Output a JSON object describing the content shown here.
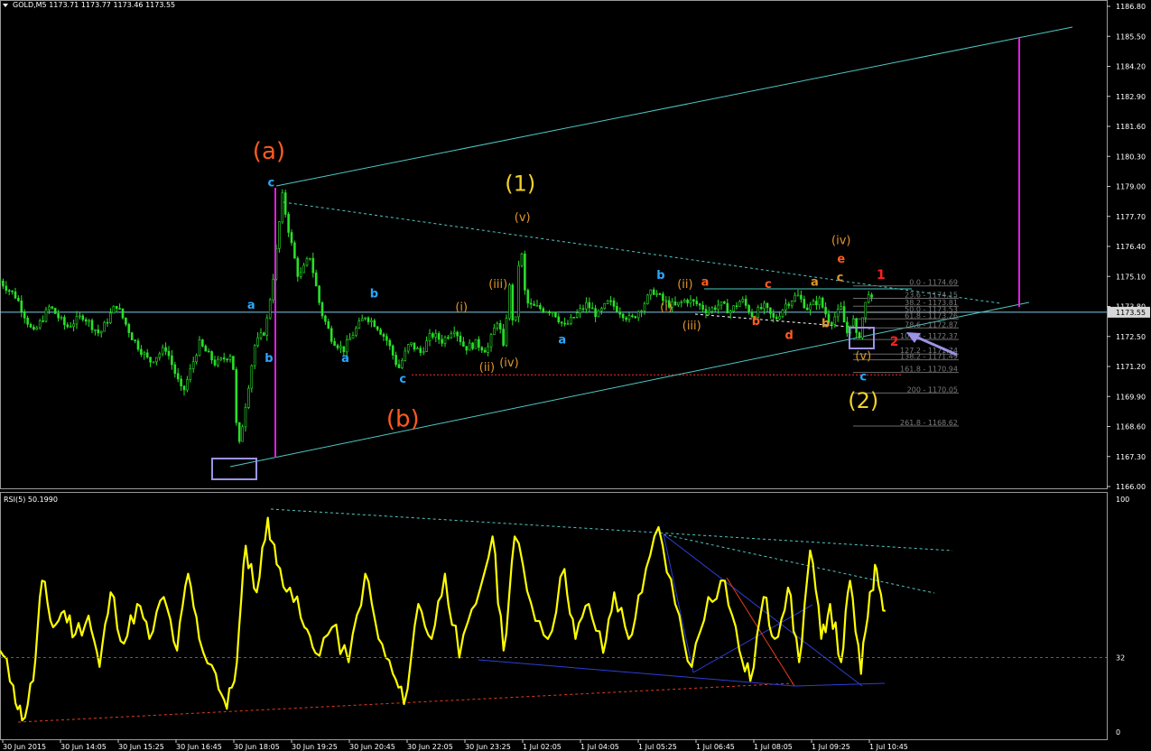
{
  "chart_data": [
    {
      "type": "candlestick",
      "title": "GOLD,M5 1173.71 1173.77 1173.46 1173.55",
      "symbol": "GOLD",
      "timeframe": "M5",
      "ohlc_header": {
        "open": 1173.71,
        "high": 1173.77,
        "low": 1173.46,
        "close": 1173.55
      },
      "current_price": 1173.55,
      "y_ticks": [
        1186.8,
        1185.5,
        1184.2,
        1182.9,
        1181.6,
        1180.3,
        1179.0,
        1177.7,
        1176.4,
        1175.1,
        1173.8,
        1172.5,
        1171.2,
        1169.9,
        1168.6,
        1167.3,
        1166.0
      ],
      "ylim": [
        1166.0,
        1187.4
      ],
      "x_ticks": [
        "30 Jun 2015",
        "30 Jun 14:05",
        "30 Jun 15:25",
        "30 Jun 16:45",
        "30 Jun 18:05",
        "30 Jun 19:25",
        "30 Jun 20:45",
        "30 Jun 22:05",
        "30 Jun 23:25",
        "1 Jul 02:05",
        "1 Jul 04:05",
        "1 Jul 05:25",
        "1 Jul 06:45",
        "1 Jul 08:05",
        "1 Jul 09:25",
        "1 Jul 10:45"
      ],
      "price_path": [
        [
          0,
          1174.9
        ],
        [
          0.015,
          1174.2
        ],
        [
          0.03,
          1172.6
        ],
        [
          0.045,
          1173.8
        ],
        [
          0.06,
          1172.9
        ],
        [
          0.075,
          1173.4
        ],
        [
          0.09,
          1172.6
        ],
        [
          0.105,
          1173.9
        ],
        [
          0.12,
          1172.4
        ],
        [
          0.135,
          1171.4
        ],
        [
          0.15,
          1172.0
        ],
        [
          0.165,
          1170.0
        ],
        [
          0.18,
          1172.2
        ],
        [
          0.195,
          1171.3
        ],
        [
          0.21,
          1171.8
        ],
        [
          0.215,
          1167.4
        ],
        [
          0.222,
          1169.6
        ],
        [
          0.23,
          1172.1
        ],
        [
          0.24,
          1172.8
        ],
        [
          0.248,
          1175.5
        ],
        [
          0.255,
          1178.6
        ],
        [
          0.262,
          1176.8
        ],
        [
          0.27,
          1175.0
        ],
        [
          0.28,
          1176.0
        ],
        [
          0.29,
          1173.6
        ],
        [
          0.3,
          1172.4
        ],
        [
          0.31,
          1171.9
        ],
        [
          0.32,
          1172.7
        ],
        [
          0.33,
          1173.4
        ],
        [
          0.34,
          1173.0
        ],
        [
          0.35,
          1172.3
        ],
        [
          0.36,
          1171.1
        ],
        [
          0.37,
          1172.2
        ],
        [
          0.38,
          1171.8
        ],
        [
          0.39,
          1172.6
        ],
        [
          0.4,
          1172.3
        ],
        [
          0.41,
          1172.9
        ],
        [
          0.42,
          1172.0
        ],
        [
          0.43,
          1172.2
        ],
        [
          0.44,
          1171.9
        ],
        [
          0.45,
          1173.3
        ],
        [
          0.455,
          1171.9
        ],
        [
          0.46,
          1174.8
        ],
        [
          0.465,
          1172.4
        ],
        [
          0.47,
          1176.8
        ],
        [
          0.475,
          1174.0
        ],
        [
          0.48,
          1173.8
        ],
        [
          0.5,
          1173.6
        ],
        [
          0.51,
          1172.9
        ],
        [
          0.52,
          1173.4
        ],
        [
          0.53,
          1173.9
        ],
        [
          0.54,
          1173.4
        ],
        [
          0.55,
          1174.0
        ],
        [
          0.56,
          1173.6
        ],
        [
          0.57,
          1173.2
        ],
        [
          0.58,
          1173.8
        ],
        [
          0.59,
          1174.5
        ],
        [
          0.6,
          1174.0
        ],
        [
          0.61,
          1173.8
        ],
        [
          0.62,
          1174.1
        ],
        [
          0.63,
          1173.9
        ],
        [
          0.64,
          1173.6
        ],
        [
          0.65,
          1173.9
        ],
        [
          0.66,
          1173.6
        ],
        [
          0.67,
          1174.1
        ],
        [
          0.68,
          1173.4
        ],
        [
          0.69,
          1173.8
        ],
        [
          0.7,
          1173.2
        ],
        [
          0.71,
          1173.9
        ],
        [
          0.72,
          1174.3
        ],
        [
          0.73,
          1173.7
        ],
        [
          0.74,
          1174.1
        ],
        [
          0.75,
          1173.1
        ],
        [
          0.76,
          1173.7
        ],
        [
          0.765,
          1172.6
        ],
        [
          0.77,
          1173.4
        ],
        [
          0.775,
          1172.2
        ],
        [
          0.78,
          1173.5
        ],
        [
          0.785,
          1174.5
        ],
        [
          0.79,
          1173.6
        ]
      ],
      "horizontal_lines": [
        {
          "price": 1173.55,
          "style": "solid",
          "color": "#80c8e8"
        },
        {
          "price": 1170.84,
          "style": "dotted",
          "color": "#ff3030",
          "from": 1171.0
        }
      ],
      "fibonacci_levels": [
        {
          "label": "0.0 - 1174.69",
          "price": 1174.69
        },
        {
          "label": "23.6 - 1174.15",
          "price": 1174.15
        },
        {
          "label": "38.2 - 1173.81",
          "price": 1173.81
        },
        {
          "label": "50.0 - 1173.53",
          "price": 1173.53
        },
        {
          "label": "61.8 - 1173.26",
          "price": 1173.26
        },
        {
          "label": "78.6 - 1172.87",
          "price": 1172.87
        },
        {
          "label": "100.0 - 1172.37",
          "price": 1172.37
        },
        {
          "label": "127.2 - 1171.74",
          "price": 1171.74
        },
        {
          "label": "138.2 - 1171.49",
          "price": 1171.49
        },
        {
          "label": "161.8 - 1170.94",
          "price": 1170.94
        },
        {
          "label": "200 - 1170.05",
          "price": 1170.05
        },
        {
          "label": "261.8 - 1168.62",
          "price": 1168.62
        }
      ],
      "wave_labels": [
        {
          "text": "(a)",
          "color": "#ff5a1e",
          "x": 0.243,
          "price": 1180.2
        },
        {
          "text": "c",
          "color": "#2aa8ff",
          "x": 0.245,
          "price": 1179.0
        },
        {
          "text": "a",
          "color": "#2aa8ff",
          "x": 0.227,
          "price": 1173.7
        },
        {
          "text": "b",
          "color": "#2aa8ff",
          "x": 0.243,
          "price": 1171.4
        },
        {
          "text": "a",
          "color": "#2aa8ff",
          "x": 0.312,
          "price": 1171.4
        },
        {
          "text": "b",
          "color": "#2aa8ff",
          "x": 0.338,
          "price": 1174.2
        },
        {
          "text": "c",
          "color": "#2aa8ff",
          "x": 0.364,
          "price": 1170.5
        },
        {
          "text": "(b)",
          "color": "#ff5a1e",
          "x": 0.364,
          "price": 1168.6
        },
        {
          "text": "(i)",
          "color": "#e0962a",
          "x": 0.417,
          "price": 1173.6
        },
        {
          "text": "(ii)",
          "color": "#e0962a",
          "x": 0.44,
          "price": 1171.0
        },
        {
          "text": "(iii)",
          "color": "#e0962a",
          "x": 0.45,
          "price": 1174.6
        },
        {
          "text": "(iv)",
          "color": "#e0962a",
          "x": 0.46,
          "price": 1171.2
        },
        {
          "text": "(1)",
          "color": "#f2d22a",
          "x": 0.47,
          "price": 1178.8
        },
        {
          "text": "(v)",
          "color": "#e0962a",
          "x": 0.472,
          "price": 1177.5
        },
        {
          "text": "a",
          "color": "#2aa8ff",
          "x": 0.508,
          "price": 1172.2
        },
        {
          "text": "b",
          "color": "#2aa8ff",
          "x": 0.597,
          "price": 1175.0
        },
        {
          "text": "(ii)",
          "color": "#e0962a",
          "x": 0.619,
          "price": 1174.6
        },
        {
          "text": "a",
          "color": "#ff5a1e",
          "x": 0.637,
          "price": 1174.7
        },
        {
          "text": "(i)",
          "color": "#e0962a",
          "x": 0.602,
          "price": 1173.6
        },
        {
          "text": "(iii)",
          "color": "#e0962a",
          "x": 0.625,
          "price": 1172.8
        },
        {
          "text": "b",
          "color": "#ff5a1e",
          "x": 0.683,
          "price": 1173.0
        },
        {
          "text": "c",
          "color": "#ff5a1e",
          "x": 0.694,
          "price": 1174.6
        },
        {
          "text": "d",
          "color": "#ff5a1e",
          "x": 0.713,
          "price": 1172.4
        },
        {
          "text": "b",
          "color": "#e0962a",
          "x": 0.746,
          "price": 1172.9
        },
        {
          "text": "a",
          "color": "#e0962a",
          "x": 0.736,
          "price": 1174.7
        },
        {
          "text": "c",
          "color": "#e0962a",
          "x": 0.759,
          "price": 1174.9
        },
        {
          "text": "(iv)",
          "color": "#e0962a",
          "x": 0.76,
          "price": 1176.5
        },
        {
          "text": "e",
          "color": "#ff5a1e",
          "x": 0.76,
          "price": 1175.7
        },
        {
          "text": "1",
          "color": "#ff2020",
          "x": 0.796,
          "price": 1175.0
        },
        {
          "text": "2",
          "color": "#ff2020",
          "x": 0.808,
          "price": 1172.1
        },
        {
          "text": "(v)",
          "color": "#e0962a",
          "x": 0.78,
          "price": 1171.5
        },
        {
          "text": "c",
          "color": "#2aa8ff",
          "x": 0.78,
          "price": 1170.6
        },
        {
          "text": "(2)",
          "color": "#f2d22a",
          "x": 0.78,
          "price": 1169.4
        }
      ]
    },
    {
      "type": "line",
      "title": "RSI(5) 50.1990",
      "indicator": "RSI",
      "period": 5,
      "current_value": 50.199,
      "y_ticks": [
        100,
        32,
        0
      ],
      "ylim": [
        0,
        100
      ],
      "series": [
        {
          "color": "#ffff00",
          "points": [
            [
              0,
              35
            ],
            [
              0.012,
              20
            ],
            [
              0.02,
              5
            ],
            [
              0.03,
              22
            ],
            [
              0.038,
              65
            ],
            [
              0.048,
              45
            ],
            [
              0.058,
              52
            ],
            [
              0.068,
              42
            ],
            [
              0.08,
              50
            ],
            [
              0.09,
              28
            ],
            [
              0.1,
              60
            ],
            [
              0.112,
              38
            ],
            [
              0.124,
              55
            ],
            [
              0.135,
              40
            ],
            [
              0.148,
              58
            ],
            [
              0.16,
              35
            ],
            [
              0.17,
              68
            ],
            [
              0.18,
              40
            ],
            [
              0.195,
              25
            ],
            [
              0.205,
              10
            ],
            [
              0.214,
              30
            ],
            [
              0.222,
              80
            ],
            [
              0.232,
              60
            ],
            [
              0.242,
              92
            ],
            [
              0.25,
              72
            ],
            [
              0.262,
              62
            ],
            [
              0.275,
              45
            ],
            [
              0.285,
              34
            ],
            [
              0.3,
              45
            ],
            [
              0.315,
              30
            ],
            [
              0.33,
              68
            ],
            [
              0.342,
              40
            ],
            [
              0.355,
              25
            ],
            [
              0.365,
              12
            ],
            [
              0.378,
              55
            ],
            [
              0.39,
              40
            ],
            [
              0.402,
              68
            ],
            [
              0.415,
              32
            ],
            [
              0.43,
              55
            ],
            [
              0.445,
              84
            ],
            [
              0.455,
              35
            ],
            [
              0.465,
              84
            ],
            [
              0.48,
              55
            ],
            [
              0.495,
              40
            ],
            [
              0.51,
              70
            ],
            [
              0.52,
              40
            ],
            [
              0.532,
              55
            ],
            [
              0.545,
              34
            ],
            [
              0.555,
              60
            ],
            [
              0.568,
              40
            ],
            [
              0.58,
              60
            ],
            [
              0.595,
              88
            ],
            [
              0.61,
              55
            ],
            [
              0.625,
              28
            ],
            [
              0.64,
              58
            ],
            [
              0.655,
              65
            ],
            [
              0.668,
              35
            ],
            [
              0.678,
              22
            ],
            [
              0.69,
              58
            ],
            [
              0.7,
              40
            ],
            [
              0.712,
              62
            ],
            [
              0.722,
              30
            ],
            [
              0.732,
              78
            ],
            [
              0.742,
              40
            ],
            [
              0.75,
              55
            ],
            [
              0.76,
              30
            ],
            [
              0.768,
              65
            ],
            [
              0.778,
              25
            ],
            [
              0.786,
              60
            ],
            [
              0.792,
              70
            ],
            [
              0.8,
              52
            ]
          ]
        }
      ]
    }
  ]
}
